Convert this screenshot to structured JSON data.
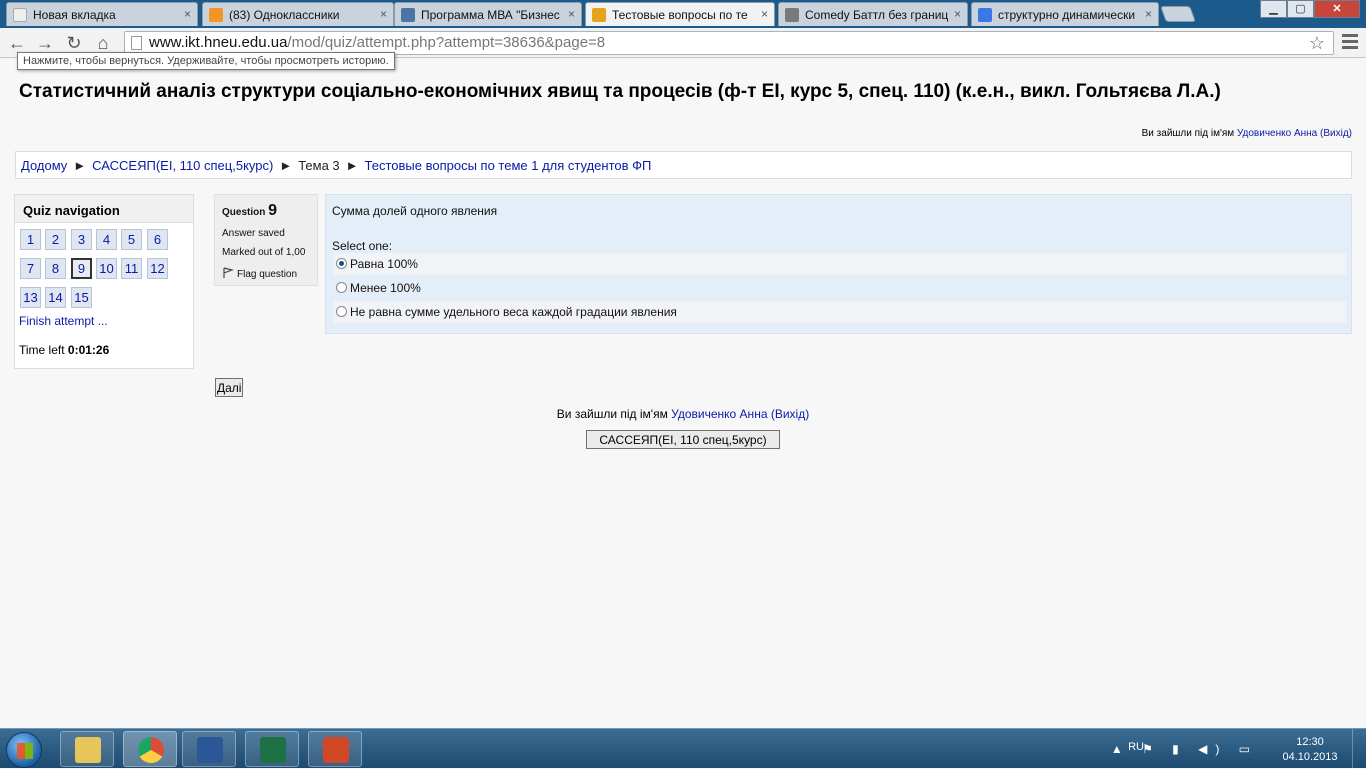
{
  "browser": {
    "tabs": [
      {
        "label": "Новая вкладка",
        "icon": "blank-page-icon",
        "active": false
      },
      {
        "label": "(83) Одноклассники",
        "icon": "odnoklassniki-icon",
        "active": false
      },
      {
        "label": "Программа МВА \"Бизнес",
        "icon": "vk-icon",
        "active": false
      },
      {
        "label": "Тестовые вопросы по те",
        "icon": "moodle-icon",
        "active": true
      },
      {
        "label": "Comedy Баттл без границ",
        "icon": "video-icon",
        "active": false
      },
      {
        "label": "структурно динамически",
        "icon": "google-icon",
        "active": false
      }
    ],
    "tab_close": "×",
    "url_host": "www.ikt.hneu.edu.ua",
    "url_path": "/mod/quiz/attempt.php?attempt=38636&page=8",
    "back_tooltip": "Нажмите, чтобы вернуться. Удерживайте, чтобы просмотреть историю.",
    "nav_glyphs": {
      "back": "←",
      "forward": "→",
      "reload": "↻",
      "home": "⌂",
      "star": "☆"
    },
    "window_glyphs": {
      "minimize": "▁",
      "maximize": "▢",
      "close": "✕"
    }
  },
  "page": {
    "site_title": "Статистичний аналіз структури соціально-економічних явищ та процесів (ф-т ЕІ, курс 5, спец. 110) (к.е.н., викл. Гольтяєва Л.А.)",
    "login_prefix": "Ви зайшли під ім'ям",
    "user_name": "Удовиченко Анна",
    "logout": "(Вихід)",
    "breadcrumb": [
      {
        "label": "Додому",
        "link": true
      },
      {
        "label": "САССЕЯП(ЕІ, 110 спец,5курс)",
        "link": true
      },
      {
        "label": "Тема 3",
        "link": false
      },
      {
        "label": "Тестовые вопросы по теме 1 для студентов ФП",
        "link": true
      }
    ],
    "breadcrumb_sep": "►",
    "quiz_nav": {
      "title": "Quiz navigation",
      "questions": [
        "1",
        "2",
        "3",
        "4",
        "5",
        "6",
        "7",
        "8",
        "9",
        "10",
        "11",
        "12",
        "13",
        "14",
        "15"
      ],
      "current": "9",
      "finish_label": "Finish attempt ...",
      "time_left_label": "Time left",
      "time_left_value": "0:01:26"
    },
    "question": {
      "label": "Question",
      "number": "9",
      "state": "Answer saved",
      "marked": "Marked out of 1,00",
      "flag_label": "Flag question",
      "text": "Сумма долей одного явления",
      "select_one": "Select one:",
      "options": [
        {
          "label": "Равна 100%",
          "selected": true
        },
        {
          "label": "Менее 100%",
          "selected": false
        },
        {
          "label": "Не равна сумме удельного веса каждой градации явления",
          "selected": false
        }
      ]
    },
    "next_button": "Далі",
    "course_button": "САССЕЯП(ЕІ, 110 спец,5курс)"
  },
  "taskbar": {
    "apps": [
      {
        "name": "explorer",
        "icon": "folder-icon",
        "color": "#e8c55a"
      },
      {
        "name": "chrome",
        "icon": "chrome-icon",
        "color": "#dd4b39"
      },
      {
        "name": "word",
        "icon": "word-icon",
        "color": "#2b5797"
      },
      {
        "name": "excel",
        "icon": "excel-icon",
        "color": "#1e7145"
      },
      {
        "name": "powerpoint",
        "icon": "powerpoint-icon",
        "color": "#d24726"
      }
    ],
    "language": "RU",
    "tray_glyphs": "▲ ⚑ ▮ ◀) ▭",
    "time": "12:30",
    "date": "04.10.2013"
  },
  "colors": {
    "link": "#0a1aa8",
    "question_bg": "#e3eef9",
    "titlebar": "#1d5a8c"
  }
}
